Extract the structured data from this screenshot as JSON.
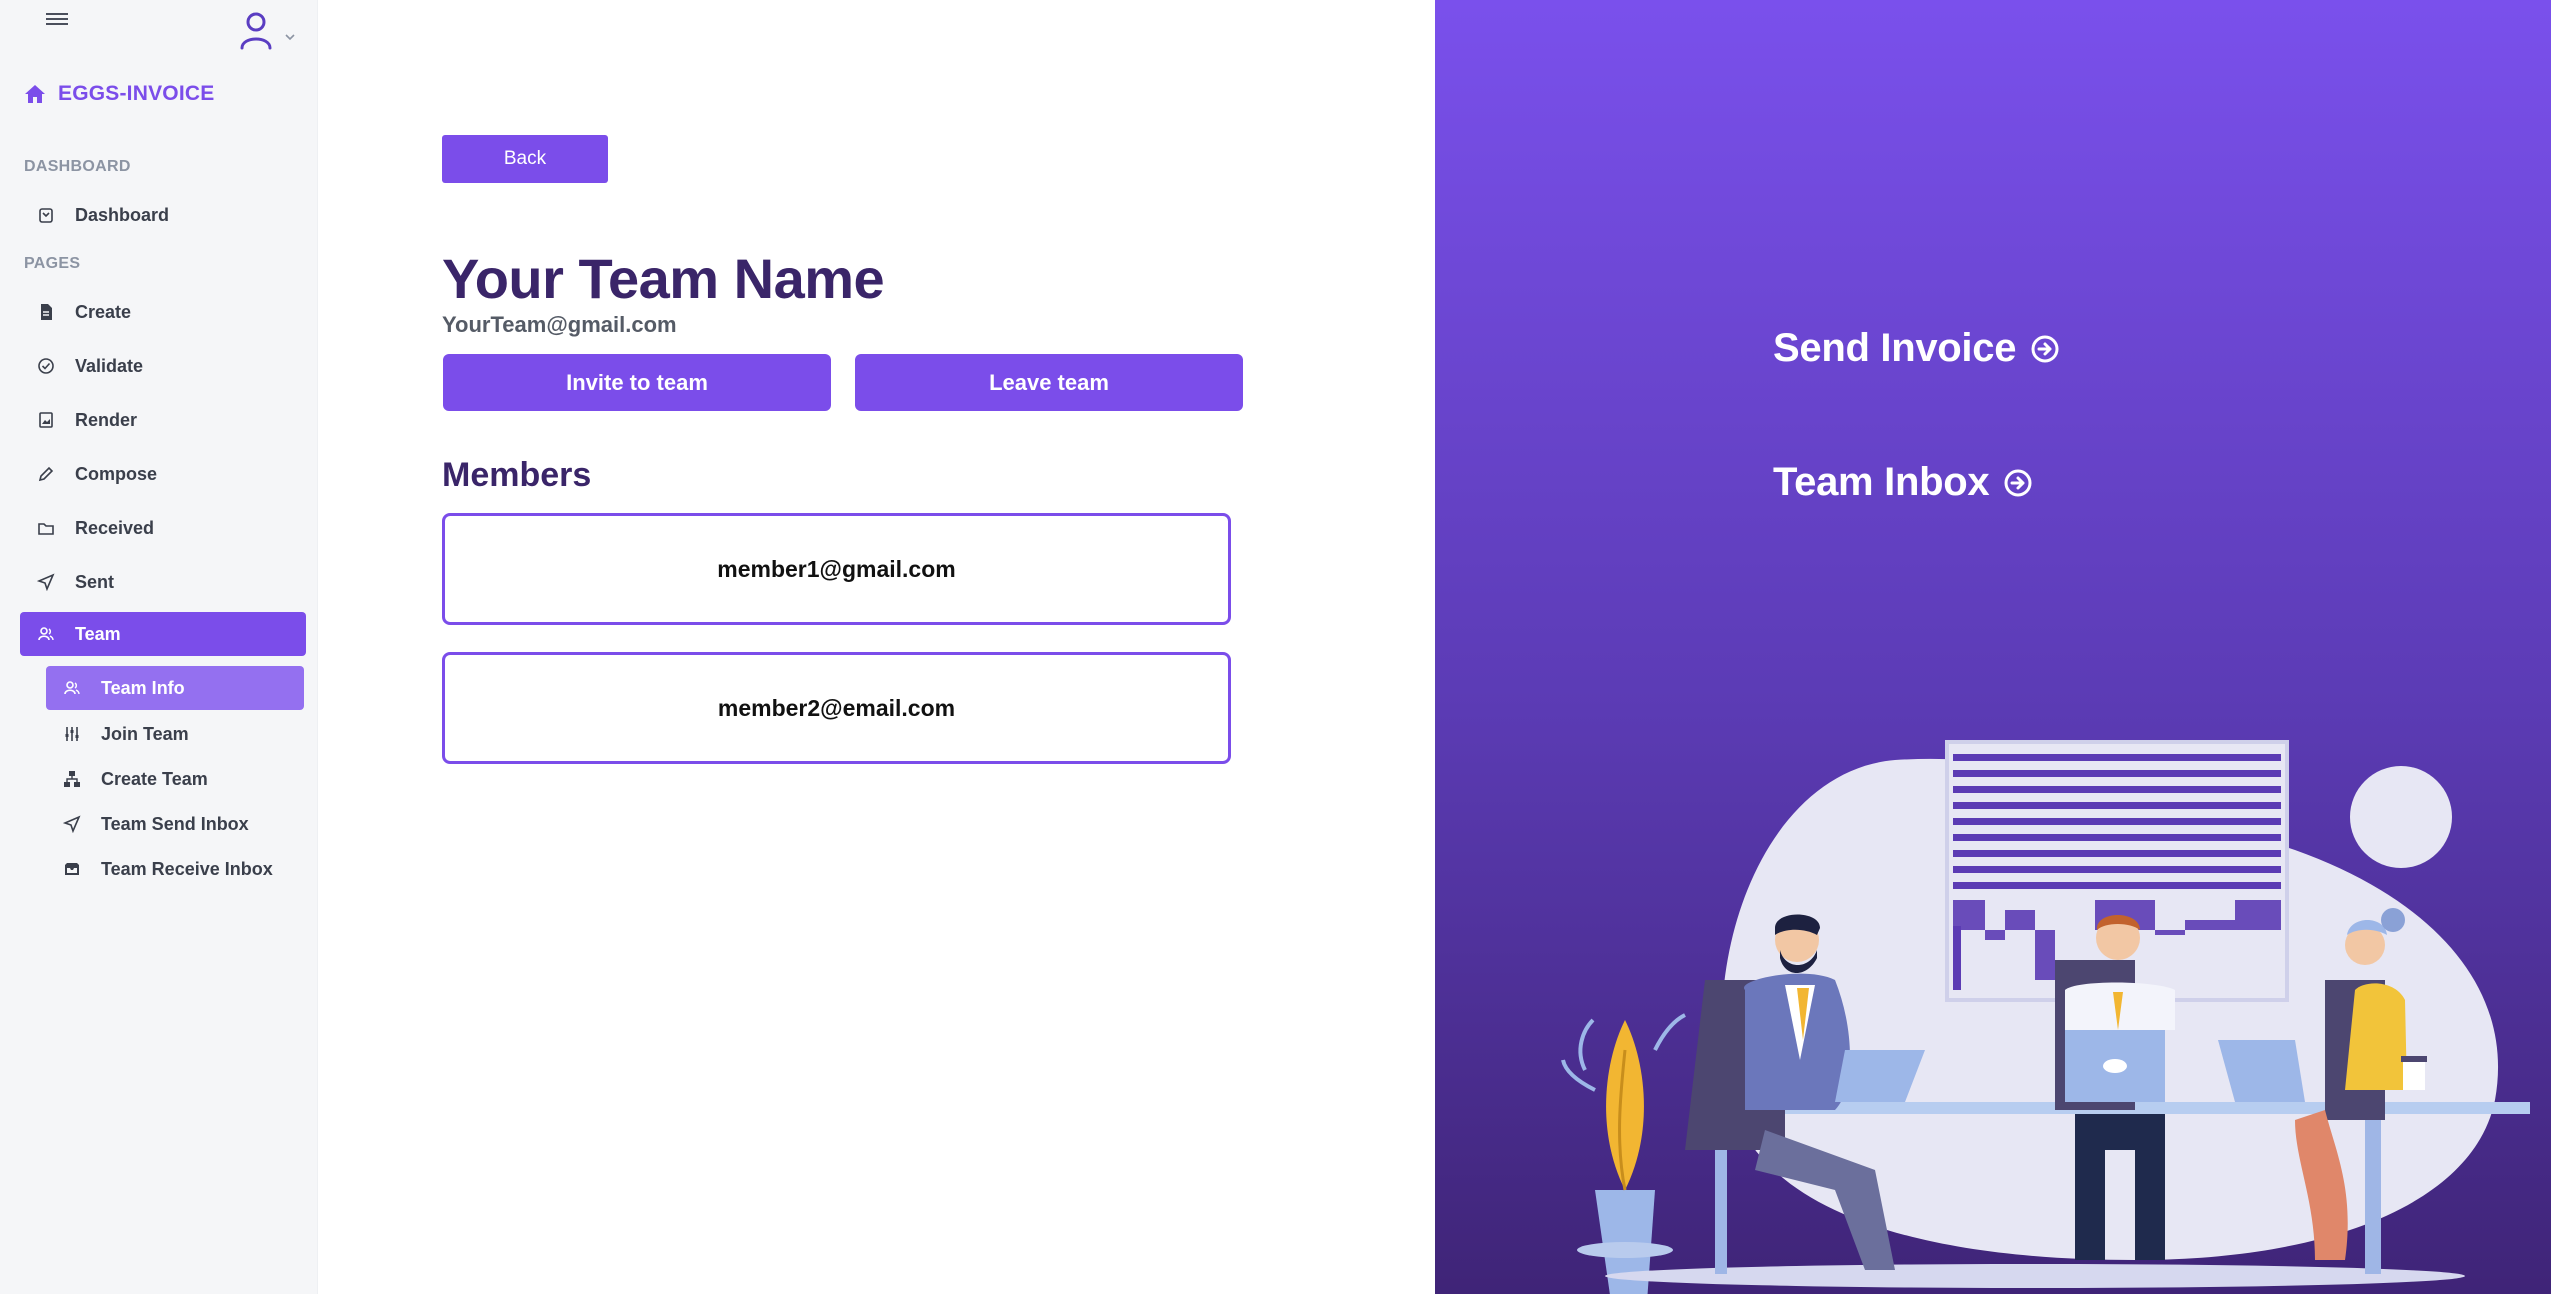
{
  "sidebar": {
    "brand": "EGGS-INVOICE",
    "sections": {
      "dashboard": "DASHBOARD",
      "pages": "PAGES"
    },
    "items": {
      "dashboard": "Dashboard",
      "create": "Create",
      "validate": "Validate",
      "render": "Render",
      "compose": "Compose",
      "received": "Received",
      "sent": "Sent",
      "team": "Team"
    },
    "team_sub": {
      "team_info": "Team Info",
      "join_team": "Join Team",
      "create_team": "Create Team",
      "team_send_inbox": "Team Send Inbox",
      "team_receive_inbox": "Team Receive Inbox"
    },
    "active_item": "Team",
    "active_sub_item": "Team Info"
  },
  "main": {
    "back_label": "Back",
    "team_name": "Your Team Name",
    "team_email": "YourTeam@gmail.com",
    "invite_label": "Invite to team",
    "leave_label": "Leave team",
    "members_heading": "Members",
    "members": [
      "member1@gmail.com",
      "member2@email.com"
    ]
  },
  "right_panel": {
    "send_invoice": "Send Invoice",
    "team_inbox": "Team Inbox"
  },
  "colors": {
    "accent": "#7b4dea",
    "accent_light": "#9470f0",
    "title": "#3a2569",
    "panel_top": "#7a50ec",
    "panel_bottom": "#3f2477"
  },
  "icons": {
    "menu": "hamburger-icon",
    "user": "user-icon",
    "brand": "home-icon",
    "link_arrow": "arrow-circle-right-icon"
  }
}
